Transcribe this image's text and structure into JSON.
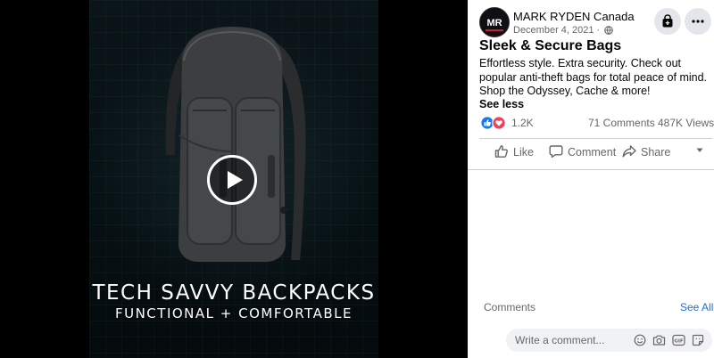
{
  "video": {
    "caption_title": "TECH SAVVY BACKPACKS",
    "caption_subtitle": "FUNCTIONAL + COMFORTABLE",
    "play_icon": "play-icon"
  },
  "post": {
    "avatar_text": "MR",
    "page_name": "MARK RYDEN Canada",
    "date": "December 4, 2021 ·",
    "privacy_icon": "globe-icon",
    "title": "Sleek & Secure Bags",
    "body": "Effortless style. Extra security. Check out popular anti-theft bags for total peace of mind. Shop the Odyssey, Cache & more!",
    "see_less": "See less"
  },
  "stats": {
    "reactions": "1.2K",
    "comments": "71 Comments",
    "views": "487K Views"
  },
  "actions": {
    "like": "Like",
    "comment": "Comment",
    "share": "Share"
  },
  "comments_section": {
    "label": "Comments",
    "see_all": "See All",
    "placeholder": "Write a comment..."
  },
  "colors": {
    "link_blue": "#216fdb",
    "like_blue": "#1877f2",
    "love_red": "#f33e58",
    "muted_text": "#65676b"
  }
}
